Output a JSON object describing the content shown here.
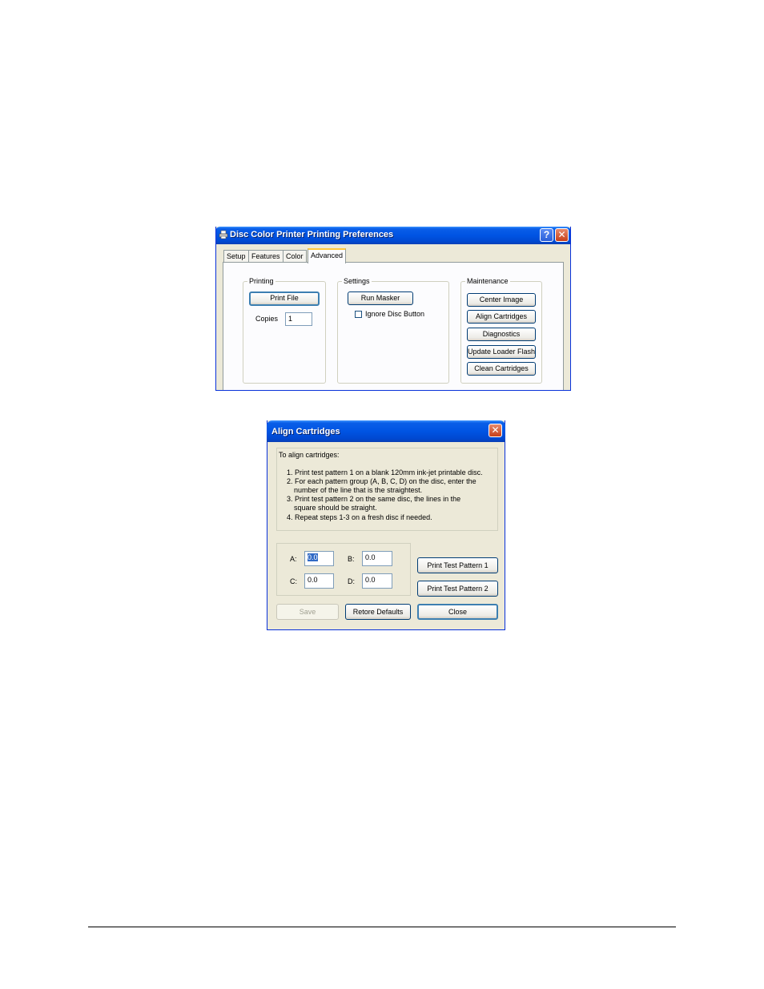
{
  "prefs_window": {
    "title": "Disc Color Printer Printing Preferences",
    "help_glyph": "?",
    "close_glyph": "✕",
    "tabs": [
      {
        "label": "Setup"
      },
      {
        "label": "Features"
      },
      {
        "label": "Color"
      },
      {
        "label": "Advanced",
        "active": true
      }
    ],
    "printing_group": {
      "title": "Printing",
      "print_file_label": "Print File",
      "copies_label": "Copies",
      "copies_value": "1"
    },
    "settings_group": {
      "title": "Settings",
      "run_masker_label": "Run Masker",
      "ignore_disc_label": "Ignore Disc Button",
      "ignore_disc_checked": false
    },
    "maintenance_group": {
      "title": "Maintenance",
      "buttons": [
        {
          "label": "Center Image"
        },
        {
          "label": "Align Cartridges"
        },
        {
          "label": "Diagnostics"
        },
        {
          "label": "Update Loader Flash"
        },
        {
          "label": "Clean Cartridges"
        }
      ]
    }
  },
  "align_window": {
    "title": "Align Cartridges",
    "close_glyph": "✕",
    "instructions": {
      "heading": "To align cartridges:",
      "lines": [
        "1. Print test pattern 1 on a blank 120mm ink-jet printable disc.",
        "2. For each pattern group (A, B, C, D) on the disc, enter the",
        "number of the line that is the straightest.",
        "3. Print test pattern 2 on the same disc, the lines in the",
        "square should be straight.",
        "4. Repeat steps 1-3 on a fresh disc if needed."
      ]
    },
    "fields": {
      "a_label": "A:",
      "a_value": "0.0",
      "b_label": "B:",
      "b_value": "0.0",
      "c_label": "C:",
      "c_value": "0.0",
      "d_label": "D:",
      "d_value": "0.0"
    },
    "buttons": {
      "print_pattern_1": "Print Test Pattern 1",
      "print_pattern_2": "Print Test Pattern 2",
      "save": "Save",
      "restore_defaults": "Retore Defaults",
      "close": "Close"
    }
  },
  "colors": {
    "titlebar": "#0054e3",
    "window_face": "#ece9d8",
    "active_tab_accent": "#ffc83c",
    "selection": "#316ac5"
  }
}
